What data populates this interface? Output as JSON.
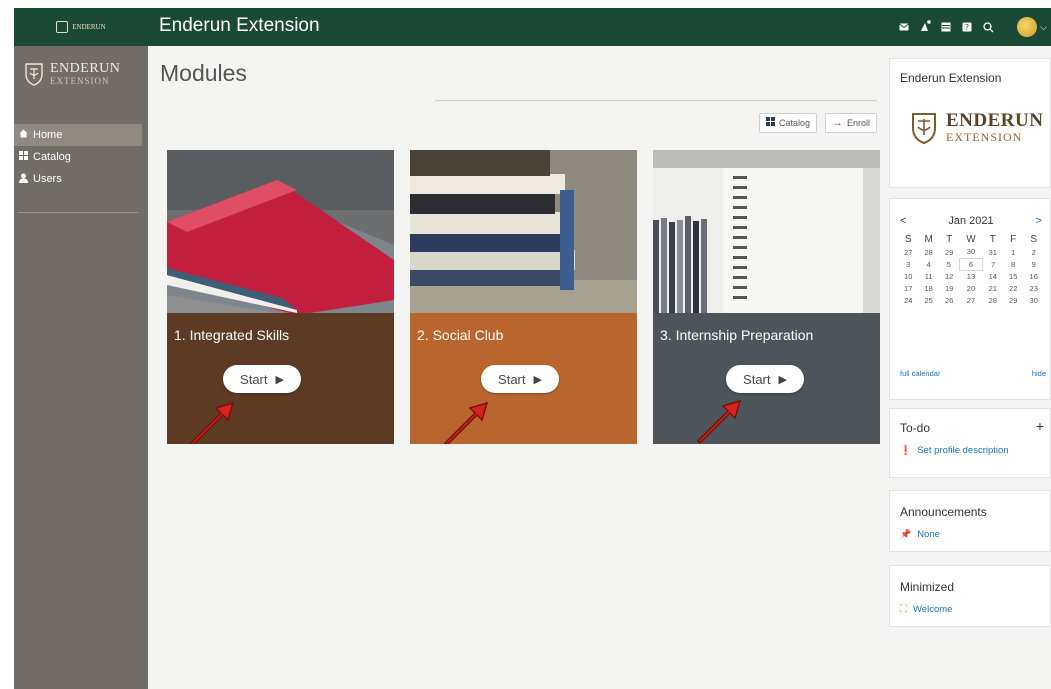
{
  "topbar": {
    "logo_text": "ENDERUN",
    "app_title": "Enderun Extension",
    "icons": [
      "mail-icon",
      "notification-icon",
      "calendar-icon",
      "help-icon",
      "search-icon",
      "user-avatar",
      "chevron-down-icon"
    ]
  },
  "sidebar": {
    "brand_line1": "ENDERUN",
    "brand_line2": "EXTENSION",
    "items": [
      {
        "label": "Home",
        "icon": "home-icon",
        "active": true
      },
      {
        "label": "Catalog",
        "icon": "grid-icon",
        "active": false
      },
      {
        "label": "Users",
        "icon": "user-icon",
        "active": false
      }
    ]
  },
  "main": {
    "title": "Modules",
    "catalog_label": "Catalog",
    "enroll_label": "Enroll",
    "cards": [
      {
        "title": "1. Integrated Skills",
        "start_label": "Start",
        "color": "#5c3b22"
      },
      {
        "title": "2. Social Club",
        "start_label": "Start",
        "color": "#b8662e"
      },
      {
        "title": "3. Internship Preparation",
        "start_label": "Start",
        "color": "#4d545a"
      }
    ]
  },
  "right": {
    "ext_title": "Enderun Extension",
    "ext_logo_line1": "ENDERUN",
    "ext_logo_line2": "EXTENSION",
    "calendar": {
      "prev": "<",
      "next": ">",
      "month": "Jan 2021",
      "days": [
        "S",
        "M",
        "T",
        "W",
        "T",
        "F",
        "S"
      ],
      "weeks": [
        [
          "27",
          "28",
          "29",
          "30",
          "31",
          "1",
          "2"
        ],
        [
          "3",
          "4",
          "5",
          "6",
          "7",
          "8",
          "9"
        ],
        [
          "10",
          "11",
          "12",
          "13",
          "14",
          "15",
          "16"
        ],
        [
          "17",
          "18",
          "19",
          "20",
          "21",
          "22",
          "23"
        ],
        [
          "24",
          "25",
          "26",
          "27",
          "28",
          "29",
          "30"
        ]
      ],
      "full_calendar": "full calendar",
      "hide": "hide"
    },
    "todo_title": "To-do",
    "todo_plus": "+",
    "todo_item": "Set profile description",
    "ann_title": "Announcements",
    "ann_item": "None",
    "min_title": "Minimized",
    "min_item": "Welcome"
  },
  "colors": {
    "topbar": "#1a4a35",
    "sidebar": "#726d67",
    "arrow": "#d8231c",
    "link": "#1a73b8"
  }
}
